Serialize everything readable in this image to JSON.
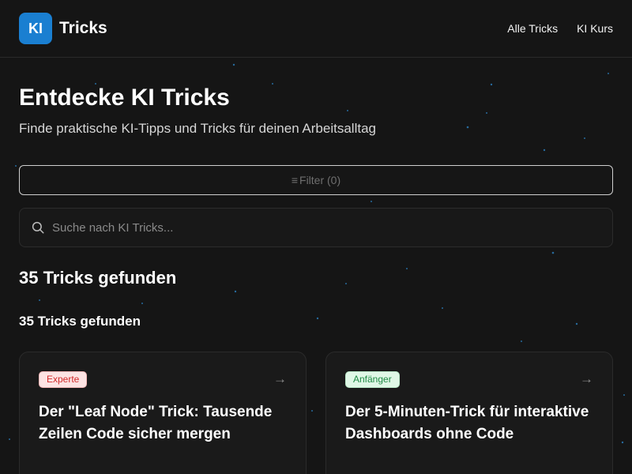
{
  "header": {
    "logo_badge": "KI",
    "logo_text": "Tricks",
    "nav": [
      {
        "label": "Alle Tricks"
      },
      {
        "label": "KI Kurs"
      }
    ]
  },
  "hero": {
    "title": "Entdecke KI Tricks",
    "subtitle": "Finde praktische KI-Tipps und Tricks für deinen Arbeitsalltag"
  },
  "filter": {
    "label": "Filter (0)",
    "icon": "menu-icon"
  },
  "search": {
    "placeholder": "Suche nach KI Tricks...",
    "value": "",
    "icon": "search-icon"
  },
  "results": {
    "count_heading": "35 Tricks gefunden",
    "count_subheading": "35 Tricks gefunden"
  },
  "cards": [
    {
      "badge": "Experte",
      "badge_color": "#d12b2b",
      "title": "Der \"Leaf Node\" Trick: Tausende Zeilen Code sicher mergen",
      "icon": "arrow-right-icon"
    },
    {
      "badge": "Anfänger",
      "badge_color": "#1f8a45",
      "title": "Der 5-Minuten-Trick für interaktive Dashboards ohne Code",
      "icon": "arrow-right-icon"
    }
  ],
  "colors": {
    "background": "#151515",
    "accent": "#1a7fd1"
  }
}
